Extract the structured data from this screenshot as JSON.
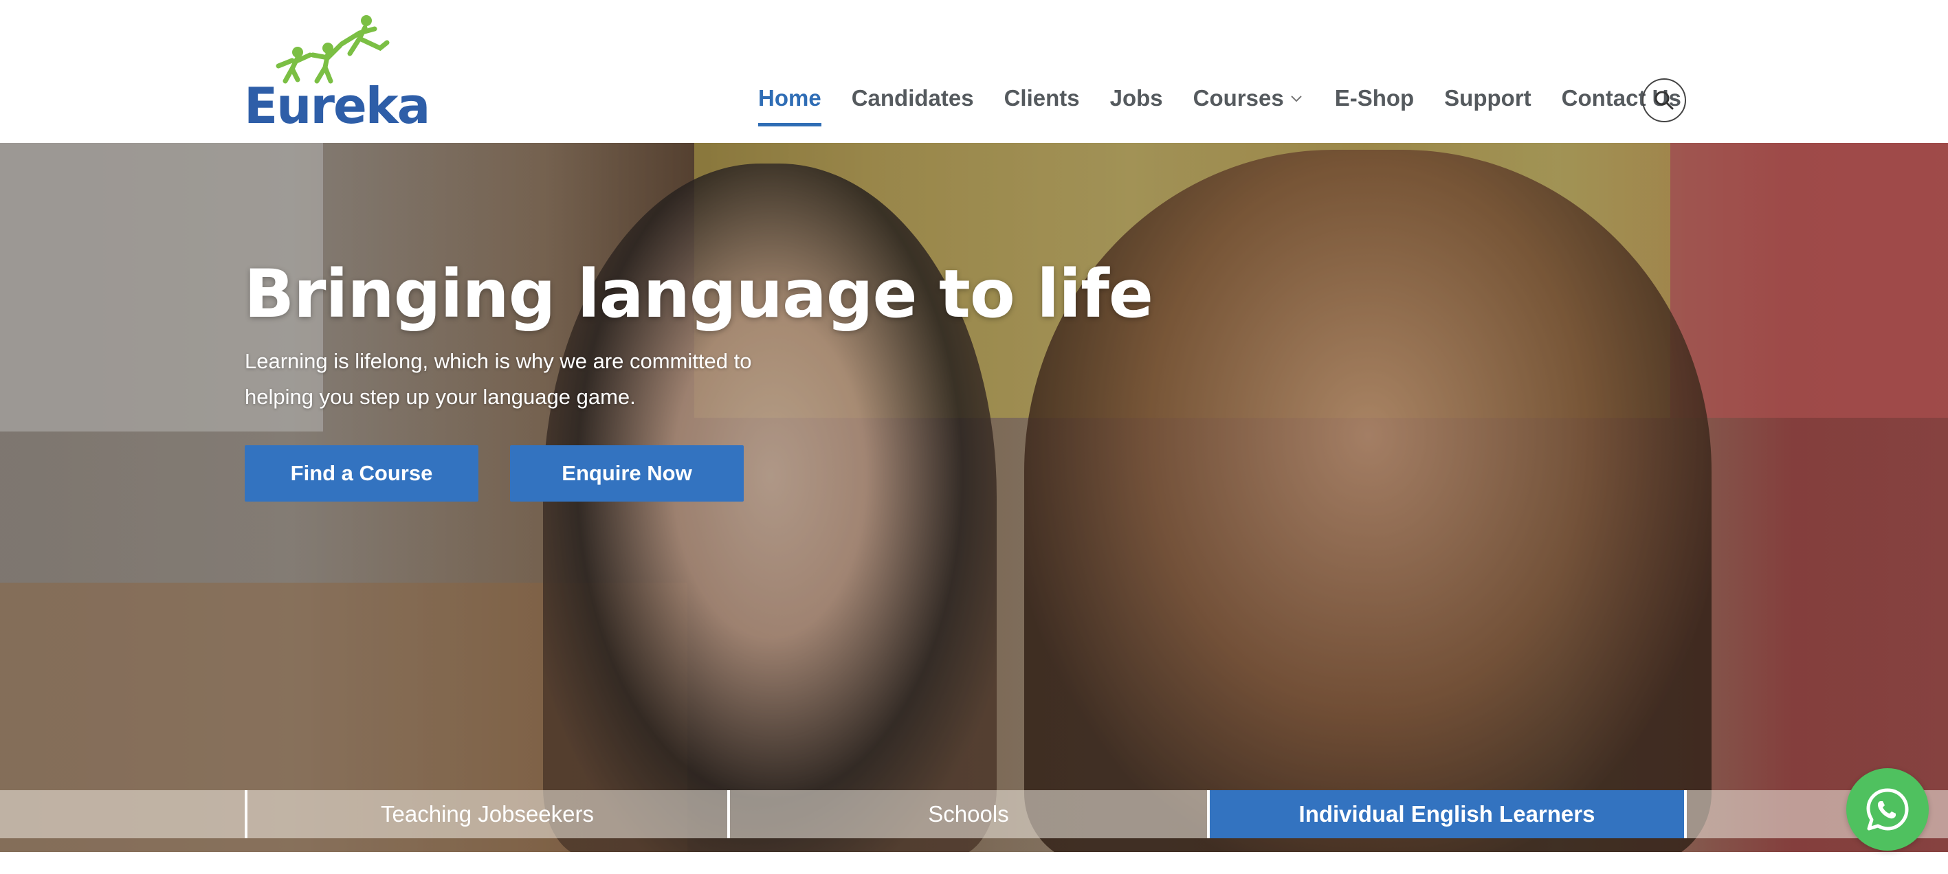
{
  "brand": {
    "logo_text": "Eureka",
    "logo_icon": "three-figures-logo-icon",
    "primary_color": "#2f6db5",
    "logo_green": "#7bbf44"
  },
  "nav": {
    "items": [
      {
        "label": "Home",
        "active": true
      },
      {
        "label": "Candidates",
        "active": false
      },
      {
        "label": "Clients",
        "active": false
      },
      {
        "label": "Jobs",
        "active": false
      },
      {
        "label": "Courses",
        "active": false,
        "has_dropdown": true
      },
      {
        "label": "E-Shop",
        "active": false
      },
      {
        "label": "Support",
        "active": false
      },
      {
        "label": "Contact Us",
        "active": false
      }
    ],
    "search_icon": "search-icon"
  },
  "hero": {
    "title": "Bringing language to life",
    "subtitle_line1": "Learning is lifelong, which is why we are committed to",
    "subtitle_line2": "helping you step up your language game.",
    "buttons": {
      "find_course": "Find a Course",
      "enquire_now": "Enquire Now"
    }
  },
  "audience_tabs": [
    {
      "label": "Teaching Jobseekers",
      "active": false
    },
    {
      "label": "Schools",
      "active": false
    },
    {
      "label": "Individual English Learners",
      "active": true
    }
  ],
  "floating": {
    "whatsapp_icon": "whatsapp-icon",
    "whatsapp_color": "#4fc15f"
  }
}
